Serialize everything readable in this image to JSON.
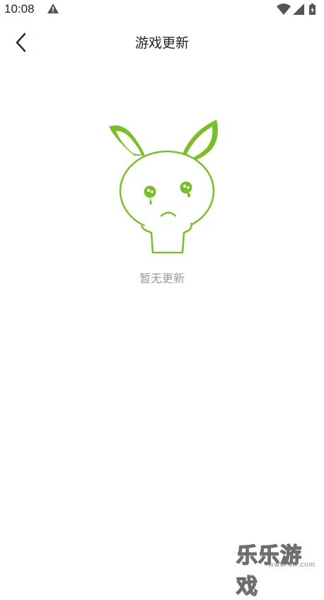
{
  "status_bar": {
    "time": "10:08",
    "icons": [
      "warning-icon",
      "wifi-icon",
      "signal-icon",
      "battery-icon"
    ]
  },
  "header": {
    "title": "游戏更新",
    "back_icon": "chevron-left-icon"
  },
  "empty_state": {
    "message": "暂无更新",
    "illustration": "sad-rabbit-icon",
    "accent_color": "#7cbd2e"
  },
  "watermark": {
    "brand": "乐乐游戏",
    "site": "www.6ll.com"
  },
  "colors": {
    "title": "#222222",
    "muted_text": "#999999",
    "back_icon": "#1f2a44"
  }
}
